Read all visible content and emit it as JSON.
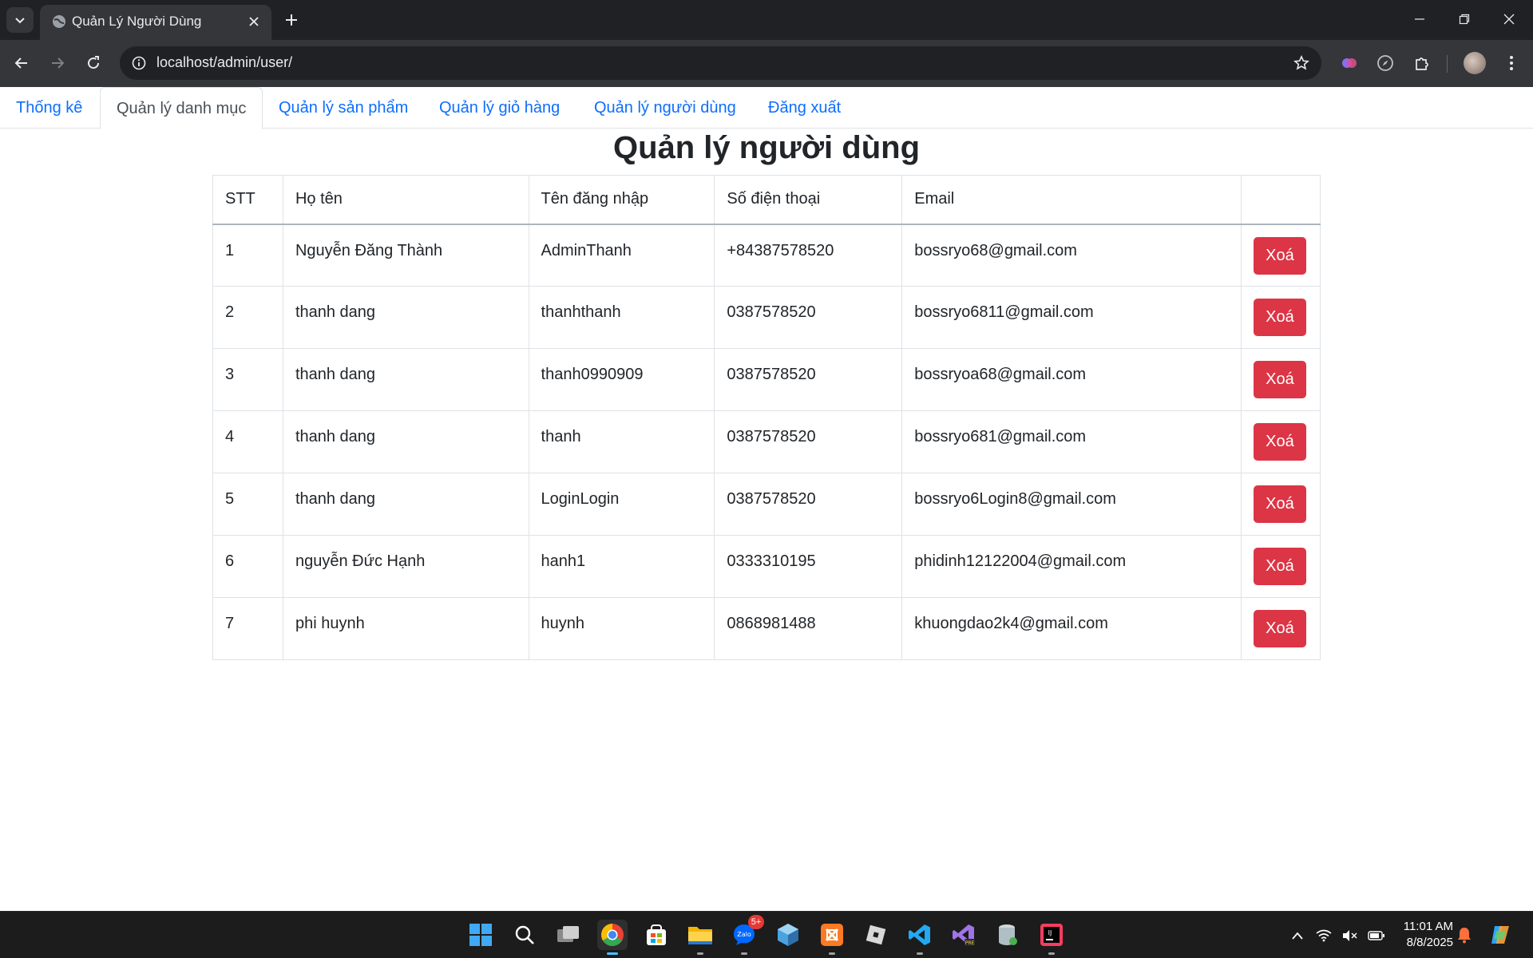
{
  "browser": {
    "tab_title": "Quản Lý Người Dùng",
    "url": "localhost/admin/user/"
  },
  "nav": {
    "items": [
      {
        "label": "Thống kê",
        "active": false
      },
      {
        "label": "Quản lý danh mục",
        "active": true
      },
      {
        "label": "Quản lý sản phẩm",
        "active": false
      },
      {
        "label": "Quản lý giỏ hàng",
        "active": false
      },
      {
        "label": "Quản lý người dùng",
        "active": false
      },
      {
        "label": "Đăng xuất",
        "active": false
      }
    ]
  },
  "page": {
    "title": "Quản lý người dùng"
  },
  "table": {
    "headers": [
      "STT",
      "Họ tên",
      "Tên đăng nhập",
      "Số điện thoại",
      "Email",
      ""
    ],
    "rows": [
      {
        "stt": "1",
        "name": "Nguyễn Đăng Thành",
        "username": "AdminThanh",
        "phone": "+84387578520",
        "email": "bossryo68@gmail.com",
        "action": "Xoá"
      },
      {
        "stt": "2",
        "name": "thanh dang",
        "username": "thanhthanh",
        "phone": "0387578520",
        "email": "bossryo6811@gmail.com",
        "action": "Xoá"
      },
      {
        "stt": "3",
        "name": "thanh dang",
        "username": "thanh0990909",
        "phone": "0387578520",
        "email": "bossryoa68@gmail.com",
        "action": "Xoá"
      },
      {
        "stt": "4",
        "name": "thanh dang",
        "username": "thanh",
        "phone": "0387578520",
        "email": "bossryo681@gmail.com",
        "action": "Xoá"
      },
      {
        "stt": "5",
        "name": "thanh dang",
        "username": "LoginLogin",
        "phone": "0387578520",
        "email": "bossryo6Login8@gmail.com",
        "action": "Xoá"
      },
      {
        "stt": "6",
        "name": "nguyễn Đức Hạnh",
        "username": "hanh1",
        "phone": "0333310195",
        "email": "phidinh12122004@gmail.com",
        "action": "Xoá"
      },
      {
        "stt": "7",
        "name": "phi huynh",
        "username": "huynh",
        "phone": "0868981488",
        "email": "khuongdao2k4@gmail.com",
        "action": "Xoá"
      }
    ]
  },
  "taskbar": {
    "time": "11:01 AM",
    "date": "8/8/2025",
    "zalo_badge": "5+"
  },
  "colors": {
    "link": "#0d6efd",
    "danger": "#dc3545",
    "chrome_dark": "#202124",
    "chrome_toolbar": "#35363a"
  }
}
